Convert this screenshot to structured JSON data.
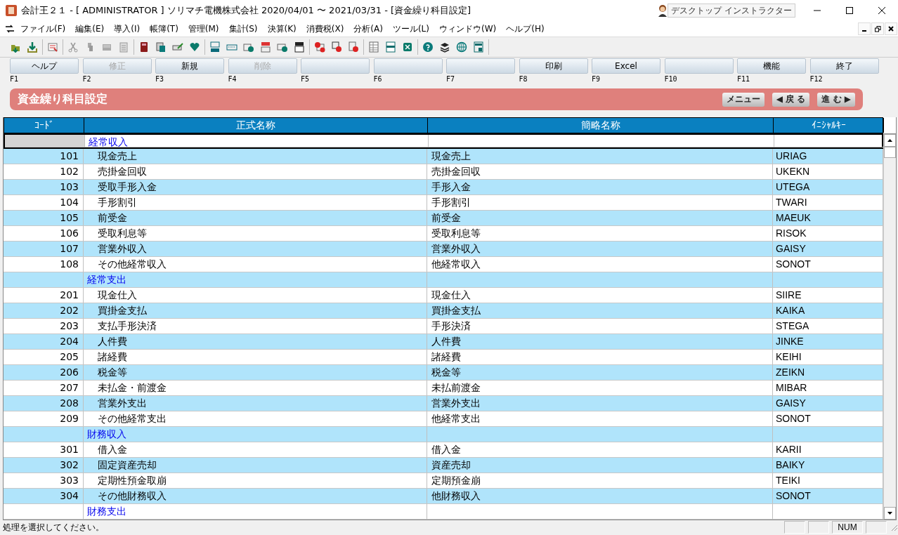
{
  "window": {
    "title": "会計王２１ - [ ADMINISTRATOR ] ソリマチ電機株式会社 2020/04/01 〜 2021/03/31 - [資金繰り科目設定]",
    "badge": "デスクトップ インストラクター"
  },
  "menu": [
    "ファイル(F)",
    "編集(E)",
    "導入(I)",
    "帳簿(T)",
    "管理(M)",
    "集計(S)",
    "決算(K)",
    "消費税(X)",
    "分析(A)",
    "ツール(L)",
    "ウィンドウ(W)",
    "ヘルプ(H)"
  ],
  "function_keys": [
    {
      "label": "ヘルプ",
      "key": "F1",
      "disabled": false
    },
    {
      "label": "修正",
      "key": "F2",
      "disabled": true
    },
    {
      "label": "新規",
      "key": "F3",
      "disabled": false
    },
    {
      "label": "削除",
      "key": "F4",
      "disabled": true
    },
    {
      "key": "F5"
    },
    {
      "key": "F6"
    },
    {
      "key": "F7"
    },
    {
      "label": "印刷",
      "key": "F8",
      "disabled": false
    },
    {
      "label": "Excel",
      "key": "F9",
      "disabled": false
    },
    {
      "key": "F10"
    },
    {
      "label": "機能",
      "key": "F11",
      "disabled": false
    },
    {
      "label": "終了",
      "key": "F12",
      "disabled": false
    }
  ],
  "page_header": {
    "title": "資金繰り科目設定",
    "buttons": [
      "メニュー",
      "◀ 戻 る",
      "進 む ▶"
    ]
  },
  "table": {
    "columns": [
      "ｺｰﾄﾞ",
      "正式名称",
      "簡略名称",
      "ｲﾆｼｬﾙｷｰ"
    ],
    "rows": [
      {
        "kind": "section",
        "name": "経常収入",
        "selected": true
      },
      {
        "kind": "item",
        "code": "101",
        "name": "現金売上",
        "short": "現金売上",
        "initial": "URIAG",
        "selected": false
      },
      {
        "kind": "item",
        "code": "102",
        "name": "売掛金回収",
        "short": "売掛金回収",
        "initial": "UKEKN",
        "selected": false
      },
      {
        "kind": "item",
        "code": "103",
        "name": "受取手形入金",
        "short": "手形入金",
        "initial": "UTEGA",
        "selected": false
      },
      {
        "kind": "item",
        "code": "104",
        "name": "手形割引",
        "short": "手形割引",
        "initial": "TWARI",
        "selected": false
      },
      {
        "kind": "item",
        "code": "105",
        "name": "前受金",
        "short": "前受金",
        "initial": "MAEUK",
        "selected": false
      },
      {
        "kind": "item",
        "code": "106",
        "name": "受取利息等",
        "short": "受取利息等",
        "initial": "RISOK",
        "selected": false
      },
      {
        "kind": "item",
        "code": "107",
        "name": "営業外収入",
        "short": "営業外収入",
        "initial": "GAISY",
        "selected": false
      },
      {
        "kind": "item",
        "code": "108",
        "name": "その他経常収入",
        "short": "他経常収入",
        "initial": "SONOT",
        "selected": false
      },
      {
        "kind": "section",
        "name": "経常支出",
        "selected": false
      },
      {
        "kind": "item",
        "code": "201",
        "name": "現金仕入",
        "short": "現金仕入",
        "initial": "SIIRE",
        "selected": false
      },
      {
        "kind": "item",
        "code": "202",
        "name": "買掛金支払",
        "short": "買掛金支払",
        "initial": "KAIKA",
        "selected": false
      },
      {
        "kind": "item",
        "code": "203",
        "name": "支払手形決済",
        "short": "手形決済",
        "initial": "STEGA",
        "selected": false
      },
      {
        "kind": "item",
        "code": "204",
        "name": "人件費",
        "short": "人件費",
        "initial": "JINKE",
        "selected": false
      },
      {
        "kind": "item",
        "code": "205",
        "name": "諸経費",
        "short": "諸経費",
        "initial": "KEIHI",
        "selected": false
      },
      {
        "kind": "item",
        "code": "206",
        "name": "税金等",
        "short": "税金等",
        "initial": "ZEIKN",
        "selected": false
      },
      {
        "kind": "item",
        "code": "207",
        "name": "未払金・前渡金",
        "short": "未払前渡金",
        "initial": "MIBAR",
        "selected": false
      },
      {
        "kind": "item",
        "code": "208",
        "name": "営業外支出",
        "short": "営業外支出",
        "initial": "GAISY",
        "selected": false
      },
      {
        "kind": "item",
        "code": "209",
        "name": "その他経常支出",
        "short": "他経常支出",
        "initial": "SONOT",
        "selected": false
      },
      {
        "kind": "section",
        "name": "財務収入",
        "selected": false
      },
      {
        "kind": "item",
        "code": "301",
        "name": "借入金",
        "short": "借入金",
        "initial": "KARII",
        "selected": false
      },
      {
        "kind": "item",
        "code": "302",
        "name": "固定資産売却",
        "short": "資産売却",
        "initial": "BAIKY",
        "selected": false
      },
      {
        "kind": "item",
        "code": "303",
        "name": "定期性預金取崩",
        "short": "定期預金崩",
        "initial": "TEIKI",
        "selected": false
      },
      {
        "kind": "item",
        "code": "304",
        "name": "その他財務収入",
        "short": "他財務収入",
        "initial": "SONOT",
        "selected": false
      },
      {
        "kind": "section",
        "name": "財務支出",
        "selected": false
      }
    ]
  },
  "status_bar": {
    "message": "処理を選択してください。",
    "indicator": "NUM"
  }
}
